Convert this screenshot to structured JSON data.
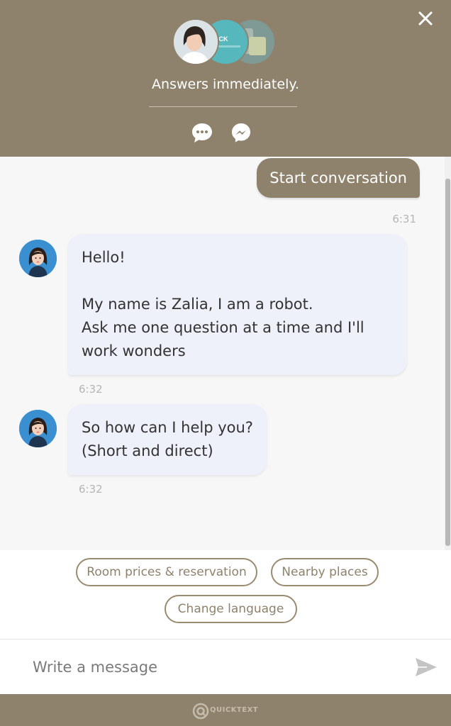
{
  "header": {
    "status_text": "Answers immediately.",
    "avatars": [
      "agent-photo",
      "brand-logo",
      "app-screenshot"
    ],
    "avatar_2_text": "ICK",
    "channels": [
      "chat-bubble-icon",
      "messenger-icon"
    ]
  },
  "messages": [
    {
      "from": "user",
      "text": "Start conversation",
      "time": "6:31"
    },
    {
      "from": "bot",
      "lines": [
        "Hello!",
        "My name is Zalia, I am a robot.",
        "Ask me one question at a time and I'll work wonders"
      ],
      "time": "6:32"
    },
    {
      "from": "bot",
      "lines": [
        "So how can I help you?",
        "(Short and direct)"
      ],
      "time": "6:32"
    }
  ],
  "quick_replies": [
    "Room prices & reservation",
    "Nearby places",
    "Change language"
  ],
  "composer": {
    "placeholder": "Write a message"
  },
  "footer": {
    "brand": "QUICKTEXT"
  },
  "colors": {
    "accent": "#8e826c",
    "bot_bubble": "#eef0fa",
    "chip_border": "#9a8b70"
  }
}
